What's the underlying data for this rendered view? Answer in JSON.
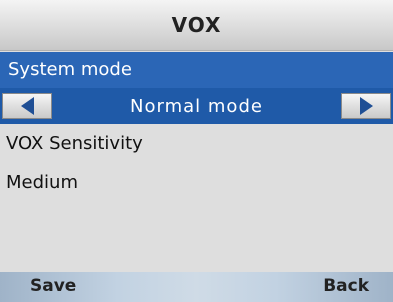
{
  "title": "VOX",
  "menu": {
    "system_mode_label": "System mode",
    "system_mode_value": "Normal mode",
    "sensitivity_label": "VOX Sensitivity",
    "sensitivity_value": "Medium"
  },
  "softkeys": {
    "left": "Save",
    "right": "Back"
  },
  "icons": {
    "prev": "left-triangle",
    "next": "right-triangle"
  },
  "colors": {
    "selection": "#2b66b6",
    "selector": "#1f5aa8"
  }
}
